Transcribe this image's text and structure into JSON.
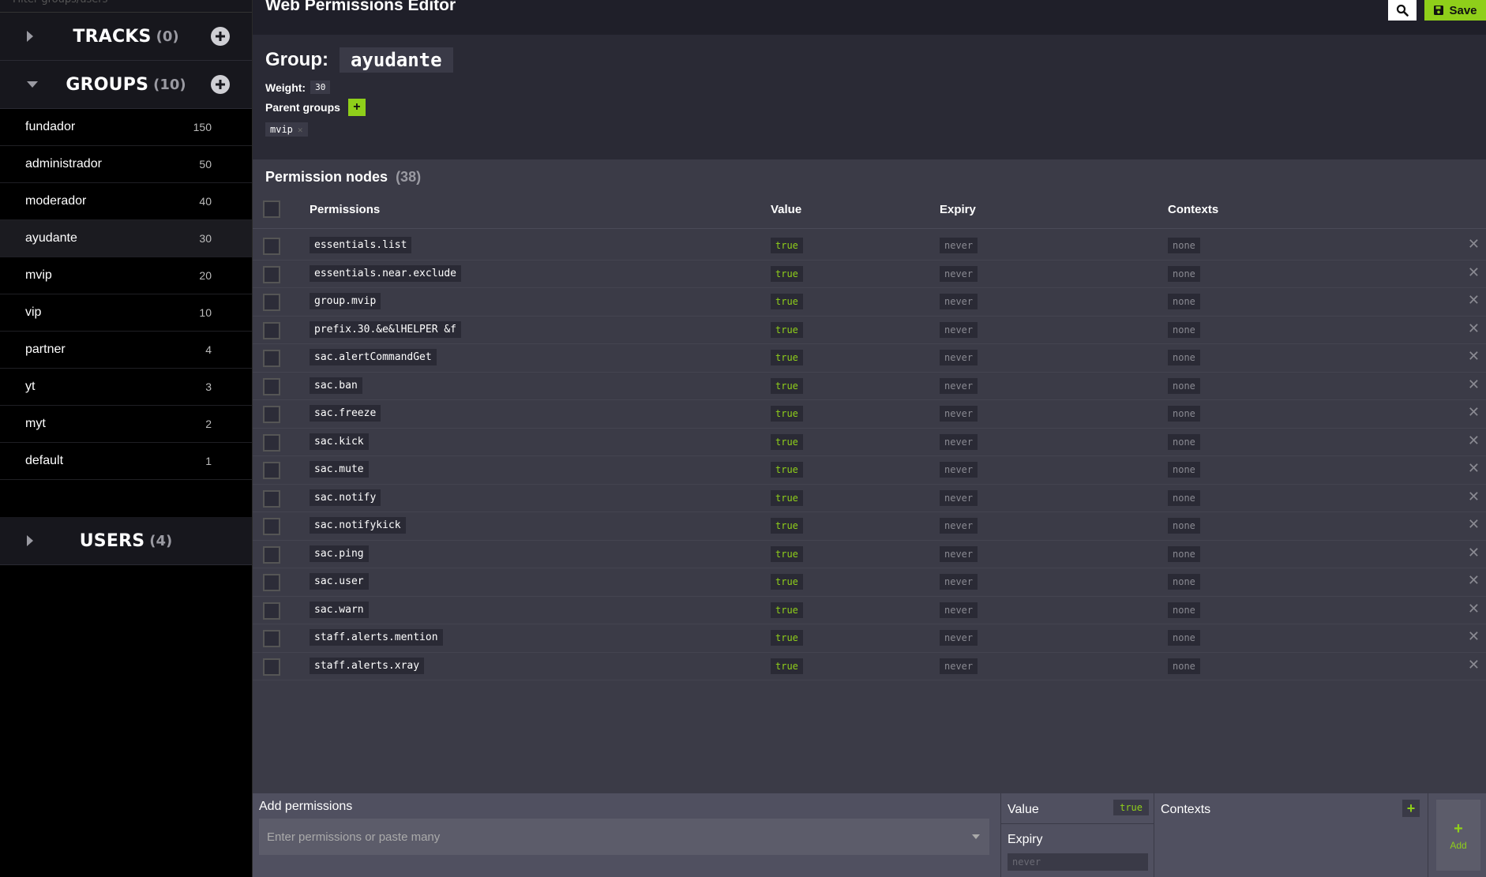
{
  "sidebar": {
    "filter_placeholder": "Filter groups/users",
    "tracks": {
      "title": "TRACKS",
      "count": "(0)"
    },
    "groups": {
      "title": "GROUPS",
      "count": "(10)",
      "items": [
        {
          "name": "fundador",
          "weight": "150"
        },
        {
          "name": "administrador",
          "weight": "50"
        },
        {
          "name": "moderador",
          "weight": "40"
        },
        {
          "name": "ayudante",
          "weight": "30",
          "active": true
        },
        {
          "name": "mvip",
          "weight": "20"
        },
        {
          "name": "vip",
          "weight": "10"
        },
        {
          "name": "partner",
          "weight": "4"
        },
        {
          "name": "yt",
          "weight": "3"
        },
        {
          "name": "myt",
          "weight": "2"
        },
        {
          "name": "default",
          "weight": "1"
        }
      ]
    },
    "users": {
      "title": "USERS",
      "count": "(4)"
    }
  },
  "header": {
    "title": "Web Permissions Editor",
    "save_label": "Save",
    "search_icon": "search-icon",
    "save_icon": "floppy-disk-icon"
  },
  "group": {
    "label": "Group:",
    "name": "ayudante",
    "weight_label": "Weight:",
    "weight": "30",
    "parents_label": "Parent groups",
    "add_parent_label": "+",
    "parents": [
      "mvip"
    ],
    "parent_remove": "✕"
  },
  "permissions": {
    "heading": "Permission nodes",
    "count": "(38)",
    "columns": {
      "permission": "Permissions",
      "value": "Value",
      "expiry": "Expiry",
      "contexts": "Contexts"
    },
    "rows": [
      {
        "node": "essentials.list",
        "value": "true",
        "expiry": "never",
        "contexts": "none"
      },
      {
        "node": "essentials.near.exclude",
        "value": "true",
        "expiry": "never",
        "contexts": "none"
      },
      {
        "node": "group.mvip",
        "value": "true",
        "expiry": "never",
        "contexts": "none"
      },
      {
        "node": "prefix.30.&e&lHELPER &f",
        "value": "true",
        "expiry": "never",
        "contexts": "none"
      },
      {
        "node": "sac.alertCommandGet",
        "value": "true",
        "expiry": "never",
        "contexts": "none"
      },
      {
        "node": "sac.ban",
        "value": "true",
        "expiry": "never",
        "contexts": "none"
      },
      {
        "node": "sac.freeze",
        "value": "true",
        "expiry": "never",
        "contexts": "none"
      },
      {
        "node": "sac.kick",
        "value": "true",
        "expiry": "never",
        "contexts": "none"
      },
      {
        "node": "sac.mute",
        "value": "true",
        "expiry": "never",
        "contexts": "none"
      },
      {
        "node": "sac.notify",
        "value": "true",
        "expiry": "never",
        "contexts": "none"
      },
      {
        "node": "sac.notifykick",
        "value": "true",
        "expiry": "never",
        "contexts": "none"
      },
      {
        "node": "sac.ping",
        "value": "true",
        "expiry": "never",
        "contexts": "none"
      },
      {
        "node": "sac.user",
        "value": "true",
        "expiry": "never",
        "contexts": "none"
      },
      {
        "node": "sac.warn",
        "value": "true",
        "expiry": "never",
        "contexts": "none"
      },
      {
        "node": "staff.alerts.mention",
        "value": "true",
        "expiry": "never",
        "contexts": "none"
      },
      {
        "node": "staff.alerts.xray",
        "value": "true",
        "expiry": "never",
        "contexts": "none"
      }
    ]
  },
  "add_bar": {
    "label": "Add permissions",
    "placeholder": "Enter permissions or paste many",
    "value_label": "Value",
    "value": "true",
    "expiry_label": "Expiry",
    "expiry_placeholder": "never",
    "contexts_label": "Contexts",
    "contexts_add": "+",
    "add_label": "Add",
    "add_plus": "+"
  },
  "colors": {
    "accent": "#8fcf1a",
    "bg": "#3b3b47",
    "sidebar": "#000000"
  }
}
